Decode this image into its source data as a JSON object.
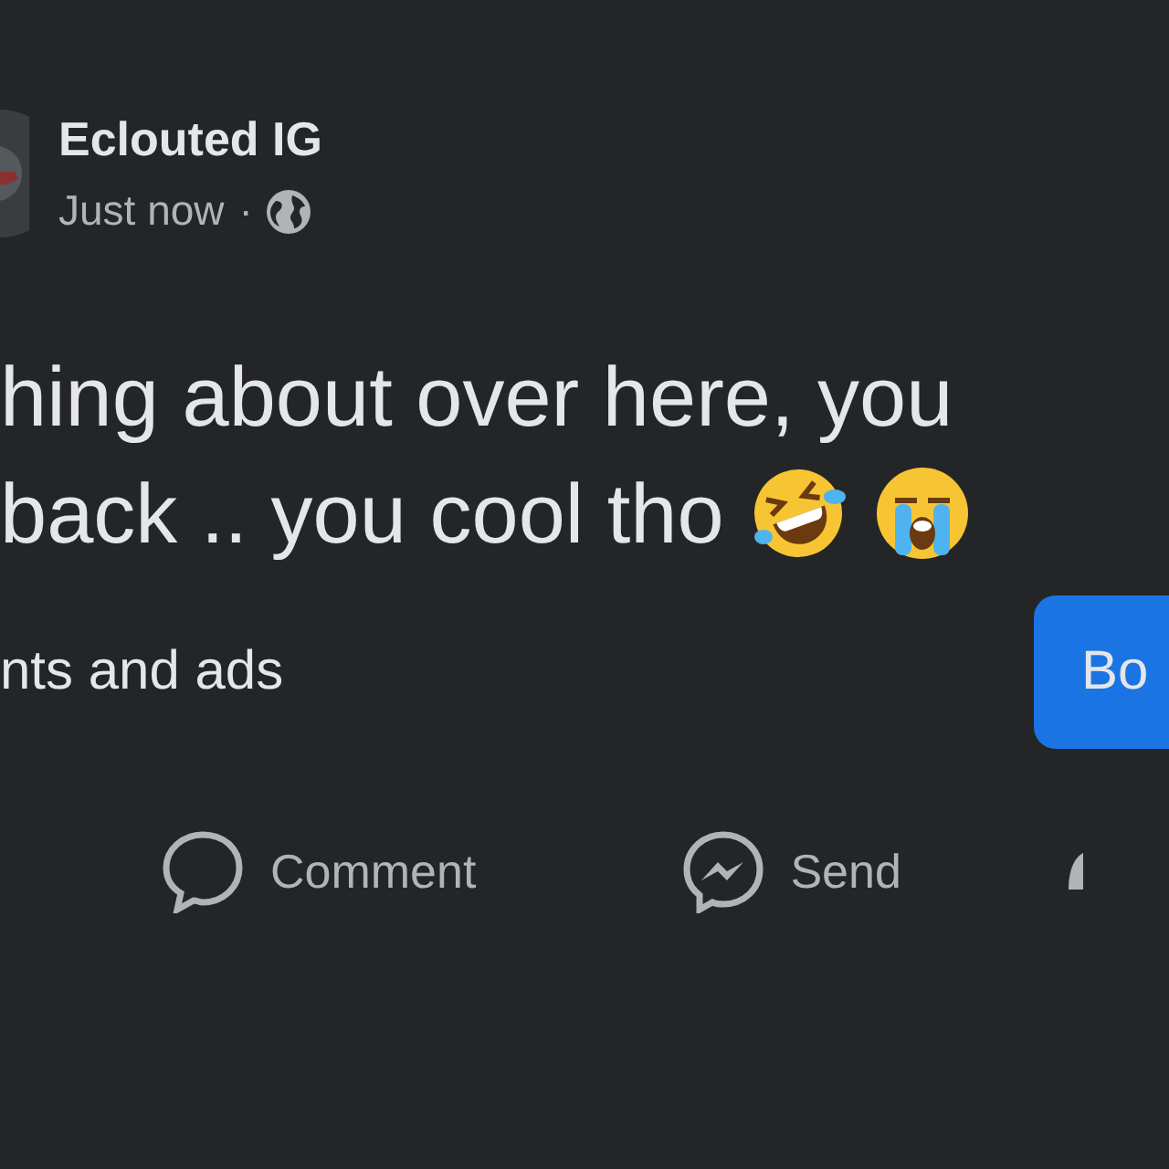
{
  "author": {
    "name": "Eclouted IG",
    "time": "Just now",
    "separator": "·"
  },
  "post": {
    "lines": [
      "hing about over here, you",
      "back .. you cool tho"
    ]
  },
  "promo": {
    "text": "nts and ads",
    "button": "Bo"
  },
  "actions": [
    {
      "kind": "comment",
      "label": "Comment"
    },
    {
      "kind": "send",
      "label": "Send"
    },
    {
      "kind": "partial"
    }
  ]
}
